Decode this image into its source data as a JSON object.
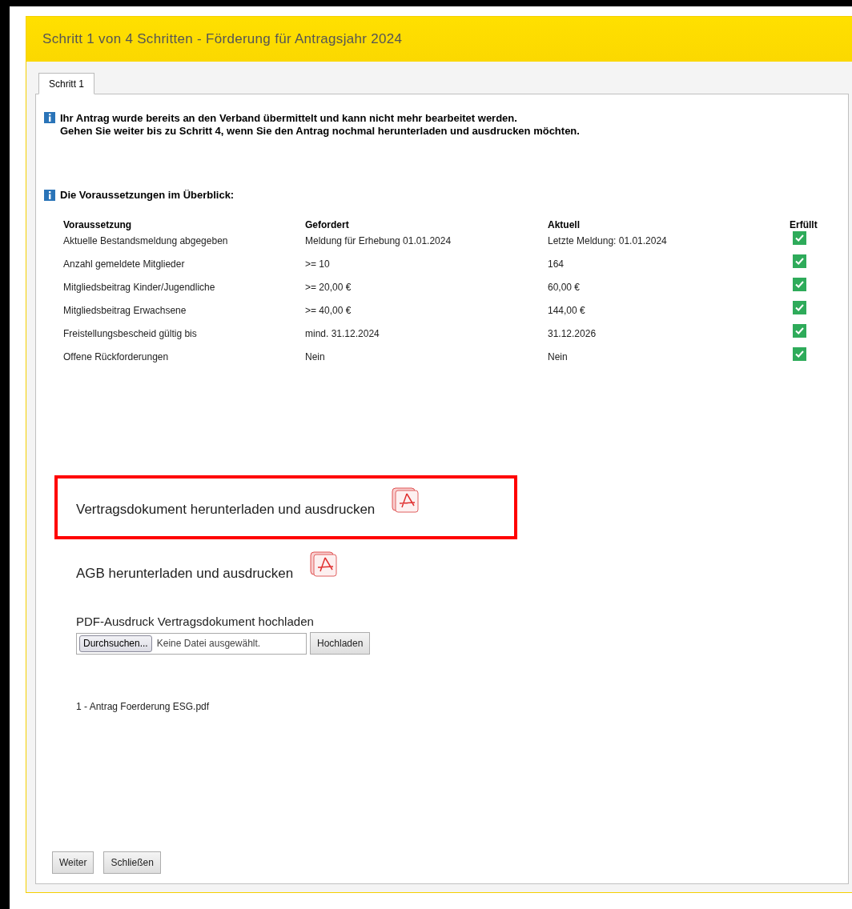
{
  "window": {
    "title": "Schritt 1 von 4 Schritten - Förderung für Antragsjahr 2024"
  },
  "tabs": [
    {
      "label": "Schritt 1",
      "selected": true
    }
  ],
  "notice": {
    "lines": [
      "Ihr Antrag wurde bereits an den Verband übermittelt und kann nicht mehr bearbeitet werden.",
      "Gehen Sie weiter bis zu Schritt 4, wenn Sie den Antrag nochmal herunterladen und ausdrucken möchten."
    ]
  },
  "requirements": {
    "heading": "Die Voraussetzungen im Überblick:",
    "columns": [
      "Voraussetzung",
      "Gefordert",
      "Aktuell",
      "Erfüllt"
    ],
    "rows": [
      {
        "requirement": "Aktuelle Bestandsmeldung abgegeben",
        "required": "Meldung für Erhebung 01.01.2024",
        "current": "Letzte Meldung: 01.01.2024",
        "met": true
      },
      {
        "requirement": "Anzahl gemeldete Mitglieder",
        "required": ">= 10",
        "current": "164",
        "met": true
      },
      {
        "requirement": "Mitgliedsbeitrag Kinder/Jugendliche",
        "required": ">= 20,00 €",
        "current": "60,00 €",
        "met": true
      },
      {
        "requirement": "Mitgliedsbeitrag Erwachsene",
        "required": ">= 40,00 €",
        "current": "144,00 €",
        "met": true
      },
      {
        "requirement": "Freistellungsbescheid gültig bis",
        "required": "mind. 31.12.2024",
        "current": "31.12.2026",
        "met": true
      },
      {
        "requirement": "Offene Rückforderungen",
        "required": "Nein",
        "current": "Nein",
        "met": true
      }
    ]
  },
  "downloads": [
    {
      "label": "Vertragsdokument herunterladen und ausdrucken",
      "highlighted": true
    },
    {
      "label": "AGB herunterladen und ausdrucken",
      "highlighted": false
    }
  ],
  "upload": {
    "label": "PDF-Ausdruck Vertragsdokument hochladen",
    "browse_button": "Durchsuchen...",
    "file_status": "Keine Datei ausgewählt.",
    "upload_button": "Hochladen"
  },
  "uploaded_files": [
    "1 - Antrag Foerderung ESG.pdf"
  ],
  "buttons": [
    "Weiter",
    "Schließen"
  ]
}
